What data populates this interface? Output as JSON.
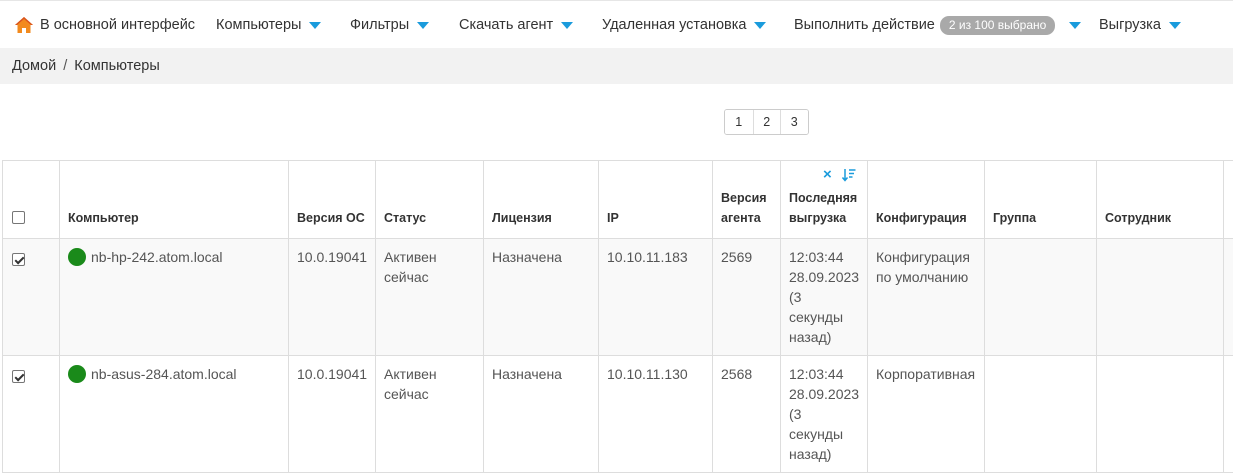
{
  "nav": {
    "home_label": "В основной интерфейс",
    "computers_label": "Компьютеры",
    "filters_label": "Фильтры",
    "download_agent_label": "Скачать агент",
    "remote_install_label": "Удаленная установка",
    "perform_action_label": "Выполнить действие",
    "selected_badge": "2 из 100 выбрано",
    "export_label": "Выгрузка"
  },
  "breadcrumb": {
    "home": "Домой",
    "separator": "/",
    "current": "Компьютеры"
  },
  "pagination": {
    "pages": [
      "1",
      "2",
      "3"
    ]
  },
  "table": {
    "sort_clear_icon": "×",
    "columns": {
      "computer": "Компьютер",
      "os_version": "Версия ОС",
      "status": "Статус",
      "license": "Лицензия",
      "ip": "IP",
      "agent_version": "Версия агента",
      "last_export": "Последняя выгрузка",
      "configuration": "Конфигурация",
      "group": "Группа",
      "employee": "Сотрудник"
    },
    "rows": [
      {
        "selected": true,
        "computer": "nb-hp-242.atom.local",
        "os_version": "10.0.19041",
        "status": "Активен сейчас",
        "license": "Назначена",
        "ip": "10.10.11.183",
        "agent_version": "2569",
        "last_export": "12:03:44 28.09.2023 (3 секунды назад)",
        "configuration": "Конфигурация по умолчанию",
        "group": "",
        "employee": ""
      },
      {
        "selected": true,
        "computer": "nb-asus-284.atom.local",
        "os_version": "10.0.19041",
        "status": "Активен сейчас",
        "license": "Назначена",
        "ip": "10.10.11.130",
        "agent_version": "2568",
        "last_export": "12:03:44 28.09.2023 (3 секунды назад)",
        "configuration": "Корпоративная",
        "group": "",
        "employee": ""
      }
    ]
  },
  "colors": {
    "accent": "#1a9bdc",
    "online_status": "#1a8a1a",
    "badge_bg": "#a9a9a9",
    "breadcrumb_bg": "#f2f2f2"
  },
  "icons": {
    "home": "home-icon",
    "dropdown": "caret-down-icon",
    "status": "online-status-icon",
    "sort_clear": "clear-sort-icon",
    "sort_order": "sort-desc-icon"
  }
}
